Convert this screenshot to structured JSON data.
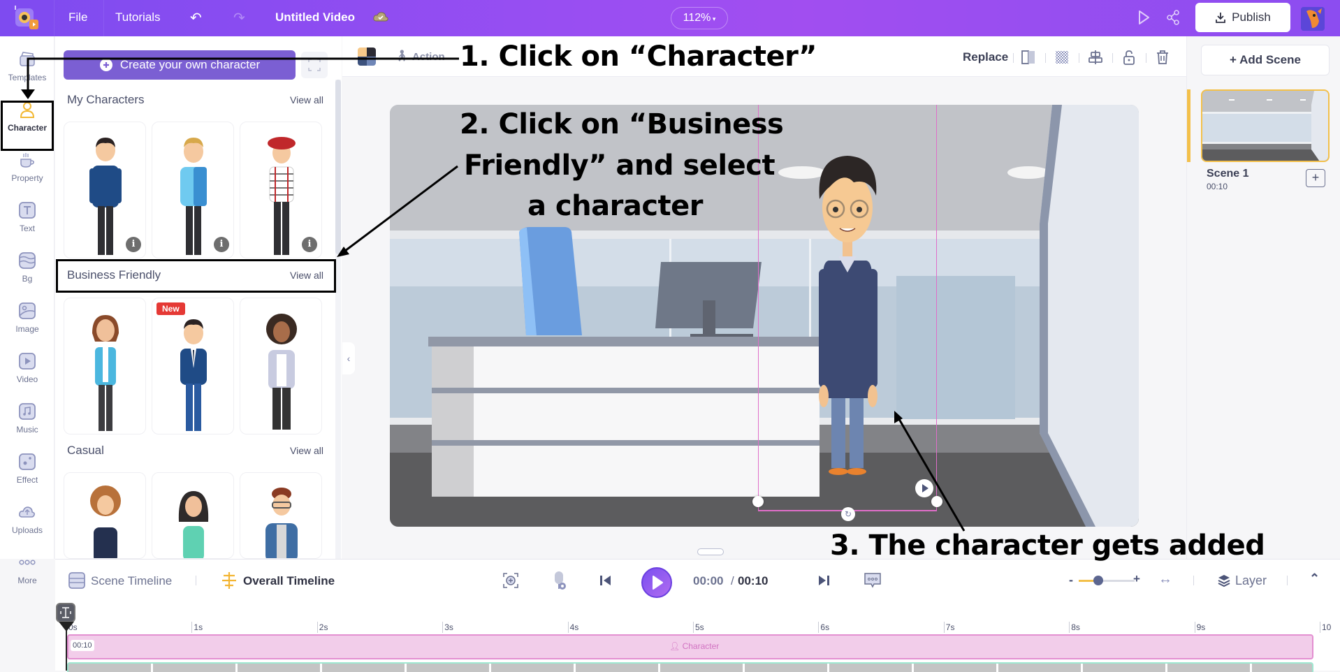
{
  "topbar": {
    "file": "File",
    "tutorials": "Tutorials",
    "title": "Untitled Video",
    "zoom": "112%",
    "publish": "Publish"
  },
  "rail": {
    "items": [
      {
        "label": "Templates",
        "icon": "templates-icon"
      },
      {
        "label": "Character",
        "icon": "character-icon",
        "active": true
      },
      {
        "label": "Property",
        "icon": "property-icon"
      },
      {
        "label": "Text",
        "icon": "text-icon"
      },
      {
        "label": "Bg",
        "icon": "background-icon"
      },
      {
        "label": "Image",
        "icon": "image-icon"
      },
      {
        "label": "Video",
        "icon": "video-icon"
      },
      {
        "label": "Music",
        "icon": "music-icon"
      },
      {
        "label": "Effect",
        "icon": "effect-icon"
      },
      {
        "label": "Uploads",
        "icon": "uploads-icon"
      },
      {
        "label": "More",
        "icon": "more-icon"
      }
    ]
  },
  "panel": {
    "create_button": "Create your own character",
    "view_all": "View all",
    "sections": [
      {
        "title": "My Characters",
        "cards": [
          "Man in blue turtleneck",
          "Man in light blue hoodie",
          "Man in beret and striped shirt"
        ]
      },
      {
        "title": "Business Friendly",
        "cards": [
          "Woman in teal blazer",
          "Man in navy suit",
          "Woman in grey cardigan"
        ],
        "badge": "New"
      },
      {
        "title": "Casual",
        "cards": [
          "Curly-haired man in hoodie",
          "Woman in green shirt",
          "Man with glasses in denim jacket"
        ]
      }
    ]
  },
  "editor": {
    "action_label": "Action",
    "replace_label": "Replace"
  },
  "scenes": {
    "add_scene": "+ Add Scene",
    "items": [
      {
        "name": "Scene 1",
        "duration": "00:10"
      }
    ]
  },
  "timeline": {
    "scene_timeline": "Scene Timeline",
    "overall_timeline": "Overall Timeline",
    "current_time": "00:00",
    "separator": "/",
    "total_time": "00:10",
    "layer": "Layer",
    "zoom_level": 0.35,
    "ticks": [
      "0s",
      "1s",
      "2s",
      "3s",
      "4s",
      "5s",
      "6s",
      "7s",
      "8s",
      "9s",
      "10"
    ],
    "track_character": {
      "duration": "00:10",
      "label": "Character"
    }
  },
  "annotations": {
    "step1": "1. Click on “Character”",
    "step2_line1": "2. Click on “Business",
    "step2_line2": "Friendly” and select",
    "step2_line3": "a character",
    "step3": "3. The character gets added"
  },
  "colors": {
    "brand_purple": "#8b4df0",
    "create_button": "#7b5fd3",
    "accent_yellow": "#f3c04a",
    "character_track": "#f2cdea",
    "new_badge": "#e53935"
  }
}
